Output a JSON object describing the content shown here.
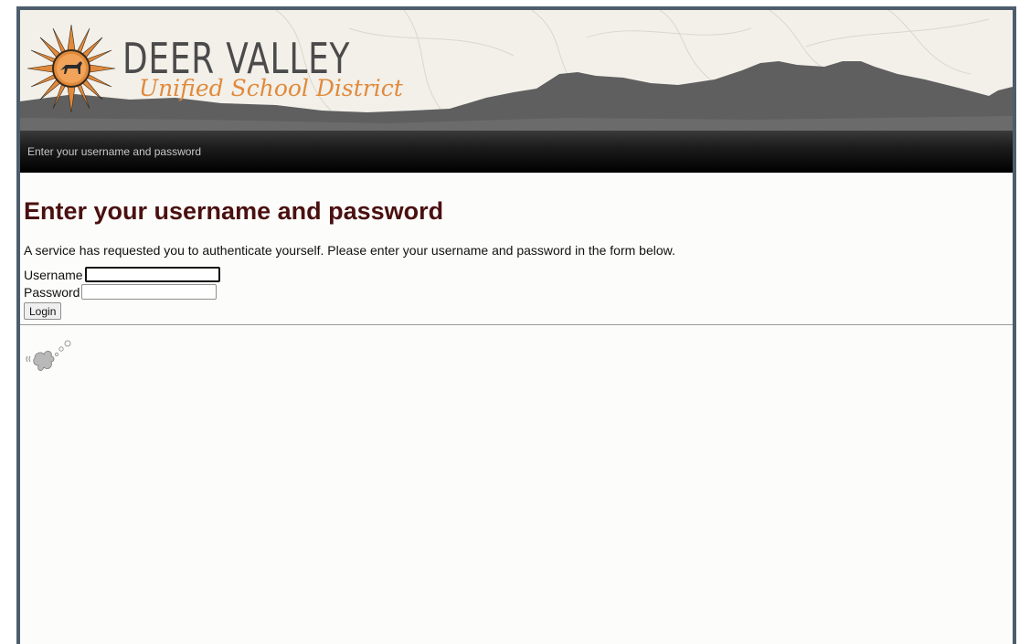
{
  "banner": {
    "title": "DEER VALLEY",
    "subtitle": "Unified School District",
    "sun_color": "#e08a3c",
    "mountain_color": "#5f5f5f"
  },
  "nav": {
    "text": "Enter your username and password"
  },
  "main": {
    "heading": "Enter your username and password",
    "intro": "A service has requested you to authenticate yourself. Please enter your username and password in the form below.",
    "username_label": "Username",
    "username_value": "",
    "password_label": "Password",
    "password_value": "",
    "login_label": "Login"
  },
  "footer": {
    "logo_icon": "simplesamlphp-logo-icon"
  },
  "colors": {
    "heading": "#4a1010",
    "frame_border": "#4e5d6c",
    "navbar": "#000000"
  }
}
